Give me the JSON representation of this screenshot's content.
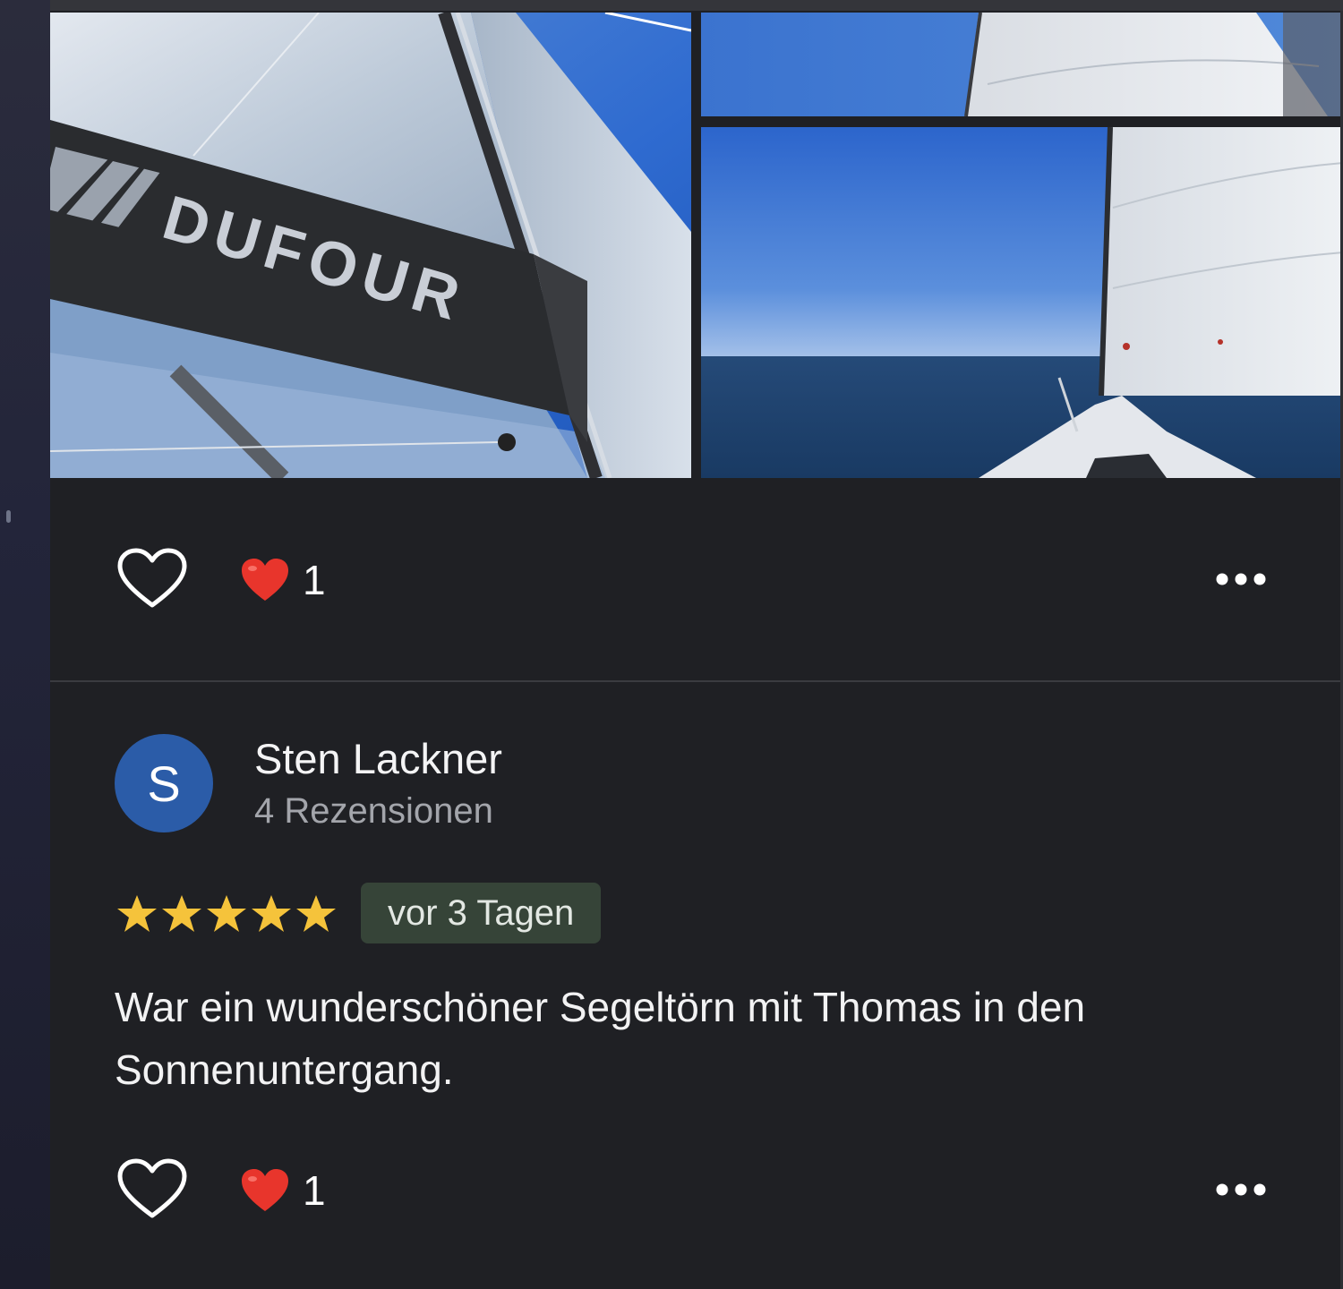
{
  "colors": {
    "background": "#1f2024",
    "avatar": "#2b5ca8",
    "star": "#f5c33b",
    "date_badge_bg": "#364438",
    "heart_reaction": "#e8352c",
    "divider": "#3a3b40"
  },
  "photos": [
    {
      "name": "sail-with-dufour-logo",
      "logo_text": "DUFOUR"
    },
    {
      "name": "sail-and-sky"
    },
    {
      "name": "bow-and-open-sea"
    }
  ],
  "photo_actions": {
    "like_icon": "heart-outline-icon",
    "reaction_icon": "red-heart-icon",
    "reaction_count": "1",
    "more_icon": "more-horizontal-icon"
  },
  "review": {
    "avatar_initial": "S",
    "author_name": "Sten Lackner",
    "author_meta": "4 Rezensionen",
    "rating": 5,
    "rating_max": 5,
    "date": "vor 3 Tagen",
    "text": "War ein wunderschöner Segeltörn mit Thomas in den Sonnenuntergang."
  },
  "review_actions": {
    "like_icon": "heart-outline-icon",
    "reaction_icon": "red-heart-icon",
    "reaction_count": "1",
    "more_icon": "more-horizontal-icon"
  }
}
